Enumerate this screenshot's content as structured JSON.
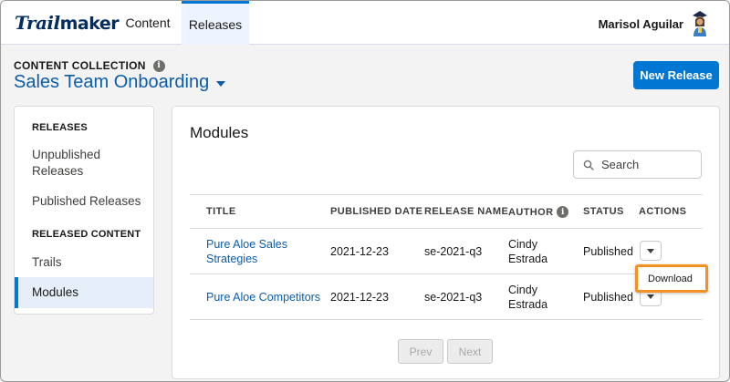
{
  "header": {
    "logo_part1": "Trail",
    "logo_part2": "maker",
    "tabs": [
      {
        "label": "Content"
      },
      {
        "label": "Releases"
      }
    ],
    "user_name": "Marisol Aguilar"
  },
  "collection": {
    "label": "CONTENT COLLECTION",
    "title": "Sales Team Onboarding",
    "new_release_label": "New Release"
  },
  "sidebar": {
    "section1": "RELEASES",
    "items1": [
      "Unpublished Releases",
      "Published Releases"
    ],
    "section2": "RELEASED CONTENT",
    "items2": [
      "Trails",
      "Modules"
    ]
  },
  "main": {
    "title": "Modules",
    "search_placeholder": "Search",
    "columns": [
      "TITLE",
      "PUBLISHED DATE",
      "RELEASE NAME",
      "AUTHOR",
      "STATUS",
      "ACTIONS"
    ],
    "rows": [
      {
        "title_line1": "Pure Aloe Sales",
        "title_line2": "Strategies",
        "date": "2021-12-23",
        "release": "se-2021-q3",
        "author_line1": "Cindy",
        "author_line2": "Estrada",
        "status": "Published"
      },
      {
        "title_line1": "Pure Aloe Competitors",
        "title_line2": "",
        "date": "2021-12-23",
        "release": "se-2021-q3",
        "author_line1": "Cindy",
        "author_line2": "Estrada",
        "status": "Published"
      }
    ],
    "dropdown_item": "Download",
    "prev_label": "Prev",
    "next_label": "Next"
  },
  "colors": {
    "brand_blue": "#0176d3",
    "link_blue": "#0b5cab",
    "highlight_orange": "#f29222"
  },
  "icons": [
    "info-icon",
    "chevron-down-icon",
    "search-icon",
    "avatar-icon"
  ]
}
